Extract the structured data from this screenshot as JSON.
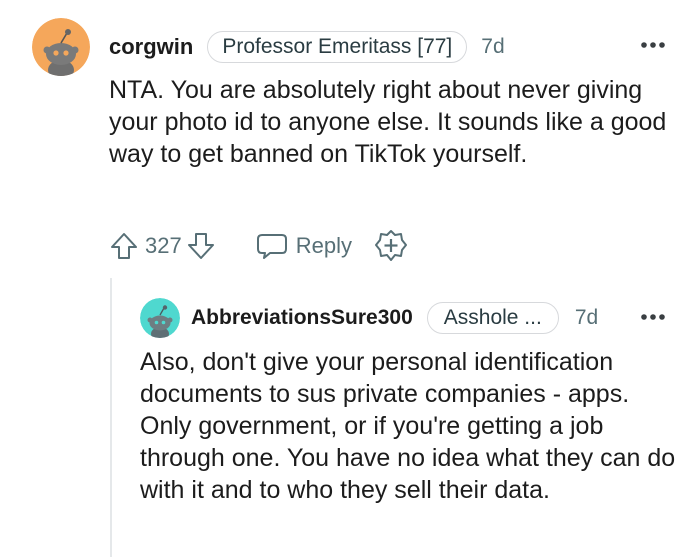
{
  "comment": {
    "username": "corgwin",
    "flair": "Professor Emeritass [77]",
    "age": "7d",
    "body": "NTA. You are absolutely right about never giving your photo id to anyone else. It sounds like a good way to get banned on TikTok yourself.",
    "vote_count": "327",
    "reply_label": "Reply",
    "avatar_color": "#f5a75b"
  },
  "reply": {
    "username": "AbbreviationsSure300",
    "flair": "Asshole ...",
    "age": "7d",
    "body": "Also, don't give your personal identification documents to sus private companies - apps. Only government, or if you're getting a job through one. You have no idea what they can do with it and to who they sell their data.",
    "avatar_color": "#4fd8cf"
  },
  "icons": {
    "more": "more-options-icon",
    "upvote": "upvote-arrow-icon",
    "downvote": "downvote-arrow-icon",
    "reply": "speech-bubble-icon",
    "award": "award-plus-icon"
  },
  "colors": {
    "text": "#1c1c1c",
    "muted": "#576f76",
    "border": "#d7d9dc"
  }
}
